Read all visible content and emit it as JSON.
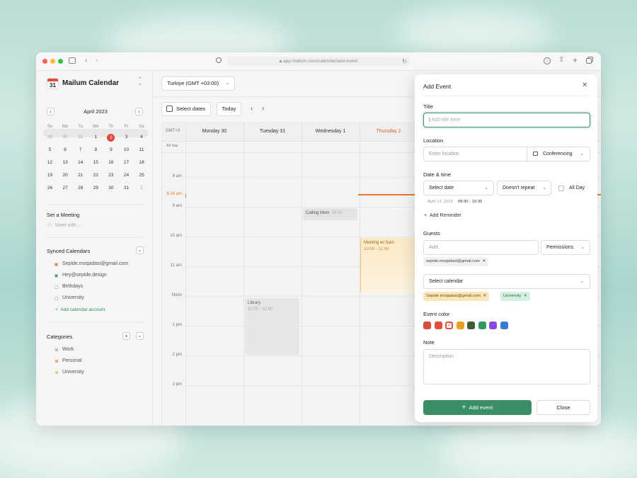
{
  "browser": {
    "url": "app.mailum.com/calendar/add-event"
  },
  "app": {
    "logo_day": "31",
    "name": "Mailum Calendar"
  },
  "mini_calendar": {
    "month": "April 2023",
    "weekdays": [
      "Su",
      "Mo",
      "Tu",
      "We",
      "Th",
      "Fr",
      "Sa"
    ],
    "weeks": [
      [
        "29",
        "30",
        "31",
        "1",
        "2",
        "3",
        "4"
      ],
      [
        "5",
        "6",
        "7",
        "8",
        "9",
        "10",
        "11"
      ],
      [
        "12",
        "13",
        "14",
        "15",
        "16",
        "17",
        "18"
      ],
      [
        "19",
        "20",
        "21",
        "22",
        "23",
        "24",
        "25"
      ],
      [
        "26",
        "27",
        "28",
        "29",
        "30",
        "31",
        "1"
      ]
    ],
    "today": "2"
  },
  "meeting": {
    "title": "Set a Meeting",
    "placeholder": "Meet with..."
  },
  "synced": {
    "title": "Synced Calendars",
    "items": [
      {
        "label": "Sepide.moqadasi@gmail.com",
        "color": "#e08a3c"
      },
      {
        "label": "Hey@sepide.design",
        "color": "#3b9c6b"
      },
      {
        "label": "Birthdays",
        "color": "#ffffff"
      },
      {
        "label": "University",
        "color": "#ffffff"
      }
    ],
    "add": "Add calendar account"
  },
  "categories": {
    "title": "Categories",
    "items": [
      {
        "label": "Work",
        "color": "#9a9a9a"
      },
      {
        "label": "Personal",
        "color": "#e0763c"
      },
      {
        "label": "University",
        "color": "#e0b23c"
      }
    ]
  },
  "toolbar": {
    "timezone": "Turkiye (GMT +03:00)",
    "select_dates": "Select dates",
    "today": "Today"
  },
  "week": {
    "gmt": "GMT+3",
    "days": [
      "Monday 30",
      "Tuesday 31",
      "Wednesday 1",
      "Thursday 2"
    ],
    "all_day": "All day",
    "hours": [
      "8 am",
      "9 am",
      "10 am",
      "11 am",
      "Noon",
      "1 pm",
      "2 pm",
      "3 pm"
    ],
    "now": "8:24 am"
  },
  "events": [
    {
      "title": "Calling Mom",
      "time": "09:00"
    },
    {
      "title": "Meeting w/ Sam",
      "time": "10:00 - 12:00"
    },
    {
      "title": "Library",
      "time": "10:00 - 12:00"
    }
  ],
  "panel": {
    "title": "Add Event",
    "title_label": "Title",
    "title_placeholder": "Add title here",
    "location_label": "Location",
    "location_placeholder": "Enter location",
    "conferencing": "Conferencing",
    "datetime_label": "Date & time",
    "select_date": "Select date",
    "repeat": "Doesn't repeat",
    "all_day": "All Day",
    "date_hint": "April 12, 2023",
    "time_hint": "08:30 - 10:30",
    "reminder": "Add Reminder",
    "guests_label": "Guests",
    "guests_placeholder": "Add..",
    "permissions": "Permissions",
    "guest_chip": "sepide.moqadasi@gmail.com",
    "select_calendar": "Select calendar",
    "calendar_chips": [
      "Sepide.moqadasi@gmail.com",
      "University"
    ],
    "color_label": "Event color",
    "colors": [
      "#d94b3b",
      "#e0503e",
      "#e0503e",
      "#e6a321",
      "#3e5a2e",
      "#2f9a63",
      "#8a4ae0",
      "#3a7bd5"
    ],
    "note_label": "Note",
    "note_placeholder": "Description",
    "add_event": "Add event",
    "close": "Close"
  }
}
